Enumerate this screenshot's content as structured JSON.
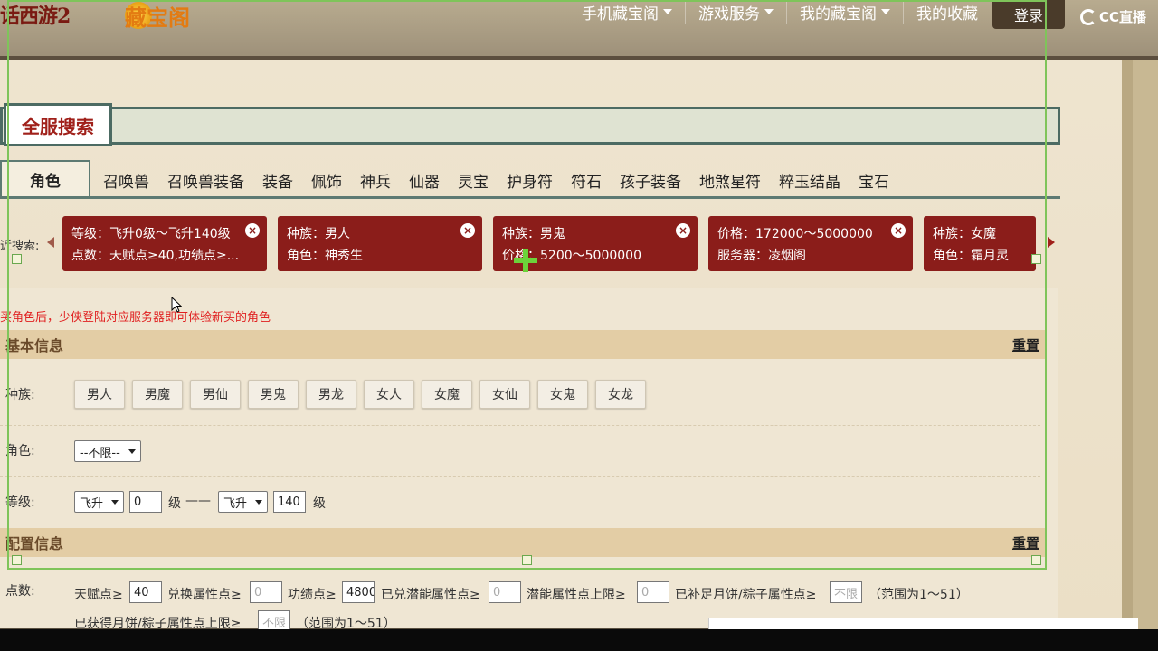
{
  "header": {
    "logo_game": "话西游2",
    "logo_site": "藏宝阁",
    "nav": [
      {
        "label": "手机藏宝阁",
        "has_caret": true
      },
      {
        "label": "游戏服务",
        "has_caret": true
      },
      {
        "label": "我的藏宝阁",
        "has_caret": true
      },
      {
        "label": "我的收藏",
        "has_caret": false
      }
    ],
    "login_label": "登录",
    "cc_label": "CC直播"
  },
  "search": {
    "title": "全服搜索",
    "tabs": [
      "角色",
      "召唤兽",
      "召唤兽装备",
      "装备",
      "佩饰",
      "神兵",
      "仙器",
      "灵宝",
      "护身符",
      "符石",
      "孩子装备",
      "地煞星符",
      "粹玉结晶",
      "宝石"
    ],
    "active_tab": 0,
    "filter_label": "近搜索:",
    "chips": [
      {
        "line1": "等级：飞升0级～飞升140级",
        "line2": "点数：天赋点≥40,功绩点≥..."
      },
      {
        "line1": "种族：男人",
        "line2": "角色：神秀生"
      },
      {
        "line1": "种族：男鬼",
        "line2": "价格：5200～5000000"
      },
      {
        "line1": "价格：172000～5000000",
        "line2": "服务器：凌烟阁"
      },
      {
        "line1": "种族：女魔",
        "line2": "角色：霜月灵"
      }
    ]
  },
  "content": {
    "notice": "买角色后，少侠登陆对应服务器即可体验新买的角色",
    "basic_section": {
      "title": "基本信息",
      "reset": "重置"
    },
    "race_label": "种族:",
    "races": [
      "男人",
      "男魔",
      "男仙",
      "男鬼",
      "男龙",
      "女人",
      "女魔",
      "女仙",
      "女鬼",
      "女龙"
    ],
    "role_label": "角色:",
    "role_select": "--不限--",
    "level_label": "等级:",
    "level_min_type": "飞升",
    "level_min": "0",
    "level_unit": "级",
    "level_sep": "——",
    "level_max_type": "飞升",
    "level_max": "140",
    "config_section": {
      "title": "配置信息",
      "reset": "重置"
    },
    "points_label": "点数:",
    "points": {
      "talent_label": "天赋点≥",
      "talent_value": "40",
      "exchange_label": "兑换属性点≥",
      "exchange_value": "0",
      "merit_label": "功绩点≥",
      "merit_value": "4800",
      "potential_label": "已兑潜能属性点≥",
      "potential_value": "0",
      "potential_max_label": "潜能属性点上限≥",
      "potential_max_value": "0",
      "mooncake_label": "已补足月饼/粽子属性点≥",
      "mooncake_placeholder": "不限",
      "range1": "（范围为1～51）",
      "mooncake_max_label": "已获得月饼/粽子属性点上限≥",
      "mooncake_max_placeholder": "不限",
      "range2": "（范围为1～51）"
    }
  }
}
